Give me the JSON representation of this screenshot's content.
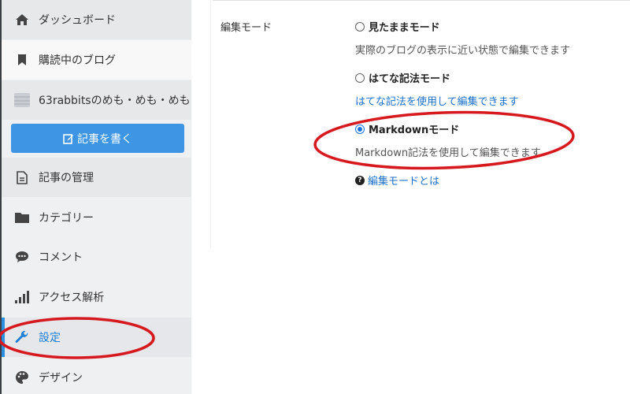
{
  "sidebar": {
    "items": [
      {
        "label": "ダッシュボード",
        "icon": "home-icon"
      },
      {
        "label": "購読中のブログ",
        "icon": "bookmark-icon"
      },
      {
        "label": "63rabbitsのめも・めも・めも",
        "icon": "blog-avatar-icon"
      },
      {
        "label": "記事の管理",
        "icon": "document-icon"
      },
      {
        "label": "カテゴリー",
        "icon": "folder-icon"
      },
      {
        "label": "コメント",
        "icon": "comment-icon"
      },
      {
        "label": "アクセス解析",
        "icon": "bar-chart-icon"
      },
      {
        "label": "設定",
        "icon": "wrench-icon"
      },
      {
        "label": "デザイン",
        "icon": "palette-icon"
      }
    ],
    "write_button": {
      "label": "記事を書く",
      "icon": "edit-icon"
    }
  },
  "settings": {
    "section_label": "編集モード",
    "options": [
      {
        "label": "見たままモード",
        "description": "実際のブログの表示に近い状態で編集できます",
        "checked": false
      },
      {
        "label": "はてな記法モード",
        "description": "はてな記法を使用して編集できます",
        "checked": false
      },
      {
        "label": "Markdownモード",
        "description": "Markdown記法を使用して編集できます",
        "checked": true
      }
    ],
    "help_link": "編集モードとは"
  },
  "colors": {
    "accent": "#2c8fe0",
    "annotation": "#d6191f"
  }
}
